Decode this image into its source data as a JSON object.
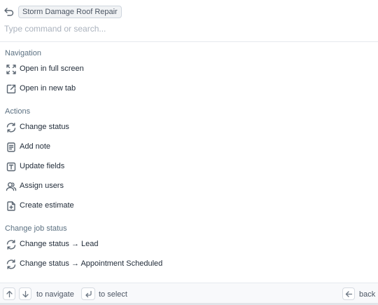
{
  "header": {
    "back_icon": "undo-arrow-icon",
    "context_chip": "Storm Damage Roof Repair",
    "search_placeholder": "Type command or search..."
  },
  "sections": {
    "navigation": {
      "title": "Navigation",
      "items": [
        {
          "label": "Open in full screen",
          "icon": "expand-icon"
        },
        {
          "label": "Open in new tab",
          "icon": "external-link-icon"
        }
      ]
    },
    "actions": {
      "title": "Actions",
      "items": [
        {
          "label": "Change status",
          "icon": "refresh-icon"
        },
        {
          "label": "Add note",
          "icon": "note-icon"
        },
        {
          "label": "Update fields",
          "icon": "text-field-icon"
        },
        {
          "label": "Assign users",
          "icon": "users-icon"
        },
        {
          "label": "Create estimate",
          "icon": "file-plus-icon"
        }
      ]
    },
    "change_job_status": {
      "title": "Change job status",
      "items": [
        {
          "label": "Change status → Lead",
          "icon": "refresh-icon"
        },
        {
          "label": "Change status → Appointment Scheduled",
          "icon": "refresh-icon"
        }
      ]
    }
  },
  "footer": {
    "navigate_label": "to navigate",
    "select_label": "to select",
    "back_label": "back"
  }
}
